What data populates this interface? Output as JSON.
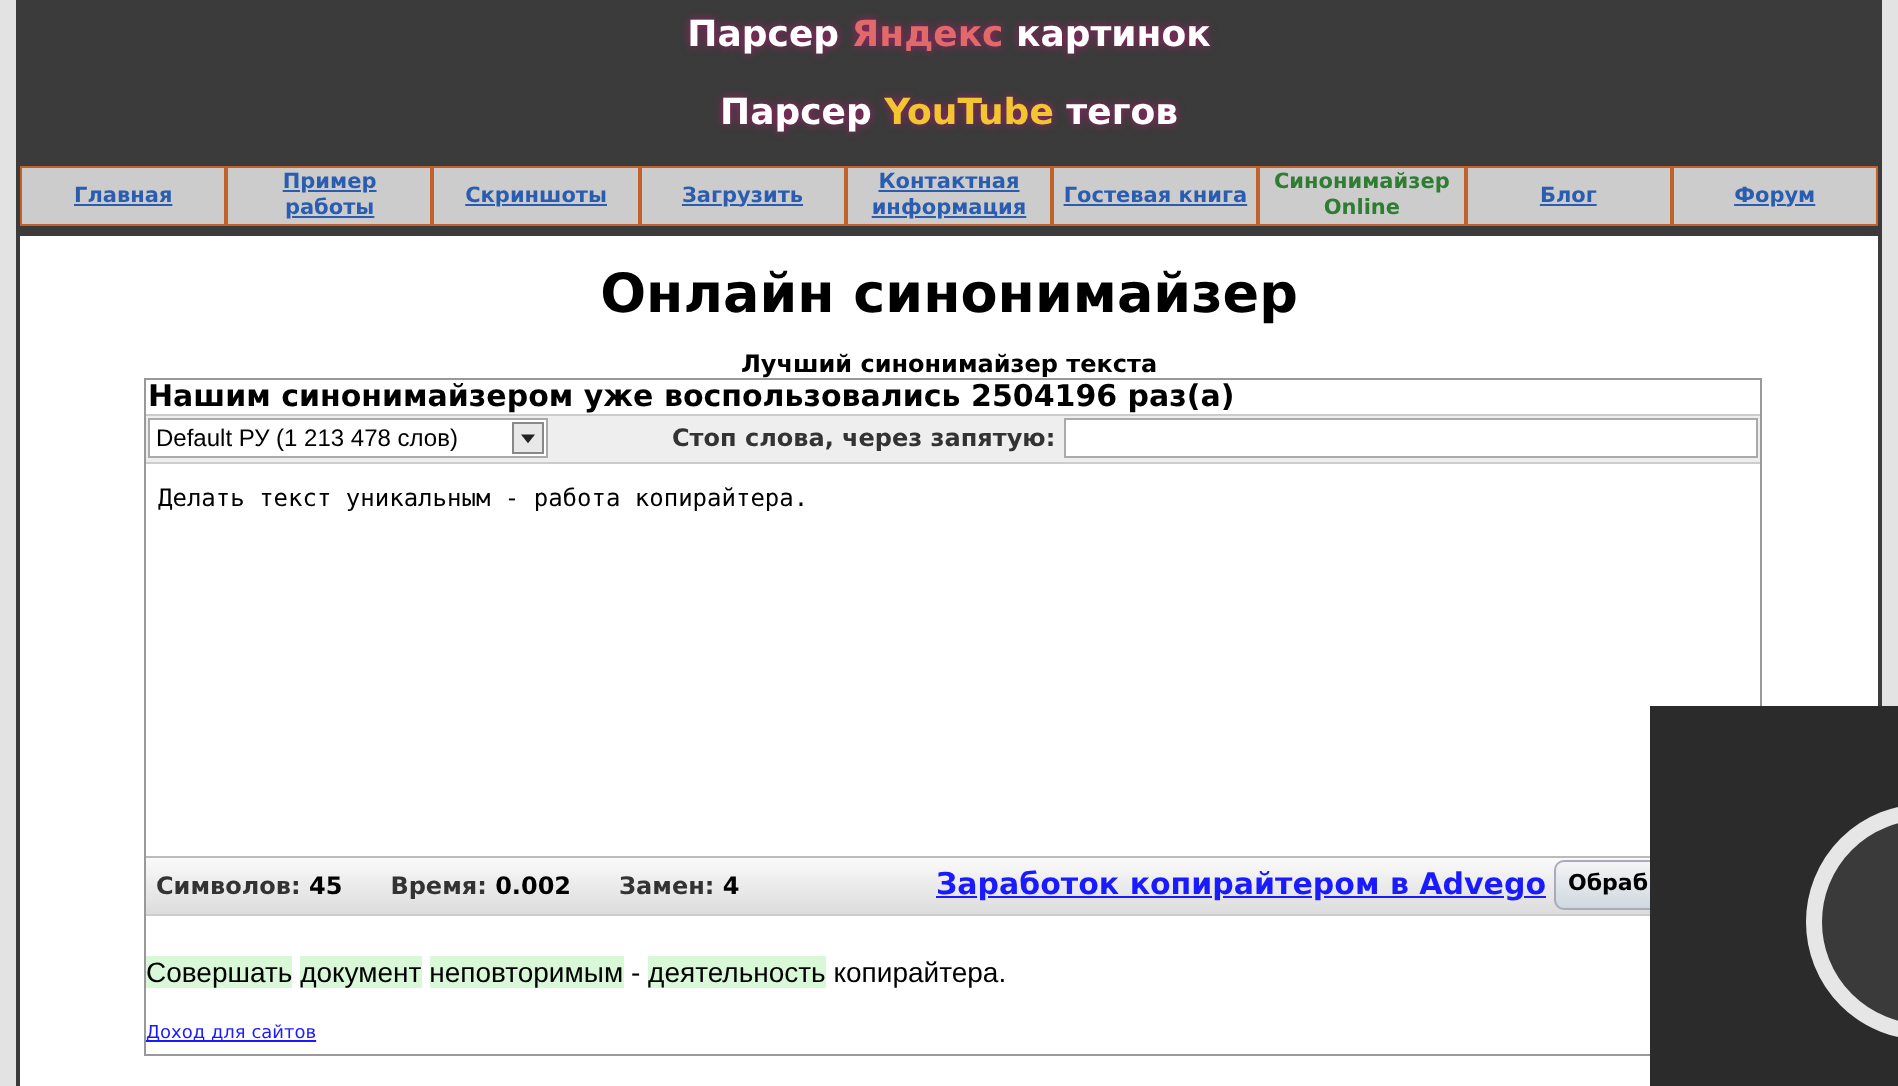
{
  "header": {
    "line1": [
      {
        "text": "Парсер ",
        "accent": false
      },
      {
        "text": "Яндекс",
        "accent": true
      },
      {
        "text": " картинок",
        "accent": false
      }
    ],
    "line2": [
      {
        "text": "Парсер ",
        "accent": false
      },
      {
        "text": "YouTube",
        "accent": true
      },
      {
        "text": " тегов",
        "accent": false
      }
    ]
  },
  "nav": [
    {
      "label": "Главная",
      "selected": false
    },
    {
      "label": "Пример работы",
      "selected": false
    },
    {
      "label": "Скриншоты",
      "selected": false
    },
    {
      "label": "Загрузить",
      "selected": false
    },
    {
      "label": "Контактная информация",
      "selected": false
    },
    {
      "label": "Гостевая книга",
      "selected": false
    },
    {
      "label": "Синонимайзер Online",
      "selected": true
    },
    {
      "label": "Блог",
      "selected": false
    },
    {
      "label": "Форум",
      "selected": false
    }
  ],
  "title": "Онлайн синонимайзер",
  "subtitle": "Лучший синонимайзер текста",
  "counter": "Нашим синонимайзером уже воспользовались 2504196 раз(а)",
  "dictionary": "Default РУ (1 213 478 слов)",
  "stopwords_label": "Стоп слова, через запятую:",
  "input_text": "Делать текст уникальным - работа копирайтера.",
  "stats": [
    {
      "label": "Символов:",
      "value": "45"
    },
    {
      "label": "Время:",
      "value": "0.002"
    },
    {
      "label": "Замен:",
      "value": "4"
    }
  ],
  "advego_link": "Заработок копирайтером в Advego",
  "process_button": "Обраб",
  "result": [
    {
      "text": "Совершать",
      "highlighted": true
    },
    {
      "text": "документ",
      "highlighted": true
    },
    {
      "text": "неповторимым",
      "highlighted": true
    },
    {
      "text": "-",
      "highlighted": false
    },
    {
      "text": "деятельность",
      "highlighted": true
    },
    {
      "text": "копирайтера.",
      "highlighted": false
    }
  ],
  "footer_link": "Доход для сайтов"
}
